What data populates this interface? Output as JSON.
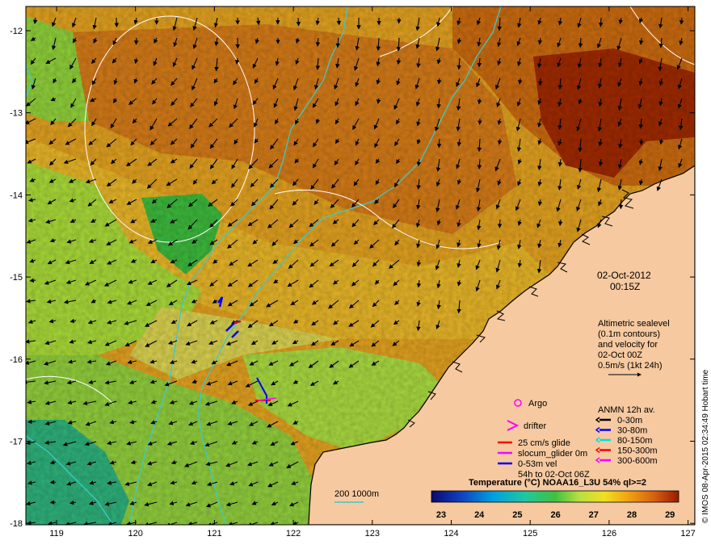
{
  "map": {
    "date": "02-Oct-2012",
    "time": "00:15Z",
    "credit": "© IMOS 08-Apr-2015 02:34:49 Hobart time",
    "lon_ticks": [
      "119",
      "120",
      "121",
      "122",
      "123",
      "124",
      "125",
      "126",
      "127"
    ],
    "lat_ticks": [
      "-12",
      "-13",
      "-14",
      "-15",
      "-16",
      "-17",
      "-18"
    ],
    "altimetry_lines": [
      "Altimetric sealevel",
      "(0.1m contours)",
      "and velocity for",
      "02-Oct 00Z",
      "0.5m/s (1kt 24h)"
    ],
    "argo_label": "Argo",
    "drifter_label": "drifter",
    "glider_lines": [
      "25 cm/s glide",
      "slocum_glider 0m",
      "0-53m vel",
      "54h to 02-Oct 06Z"
    ],
    "anmn_title": "ANMN 12h av.",
    "anmn_items": [
      {
        "label": "0-30m",
        "color": "#000000"
      },
      {
        "label": "30-80m",
        "color": "#0000ff"
      },
      {
        "label": "80-150m",
        "color": "#00e0e0"
      },
      {
        "label": "150-300m",
        "color": "#ff0000"
      },
      {
        "label": "300-600m",
        "color": "#ff00ff"
      }
    ],
    "isobath_label": "200  1000m",
    "colorbar": {
      "title": "Temperature (°C) NOAA16_L3U 54% ql>=2",
      "ticks": [
        "23",
        "24",
        "25",
        "26",
        "27",
        "28",
        "29"
      ]
    },
    "colors": {
      "land": "#f6c9a0",
      "isobath": "#3fc8c8",
      "contour": "#ffffff",
      "argo": "#ff00ff",
      "glider_red": "#ff0000",
      "glider_magenta": "#ff00ff",
      "glider_blue": "#0000ff"
    }
  }
}
